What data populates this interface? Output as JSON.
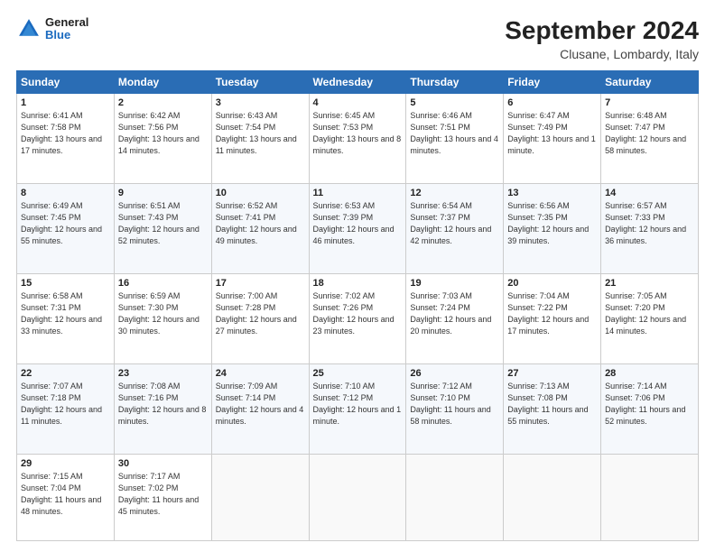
{
  "header": {
    "logo": {
      "general": "General",
      "blue": "Blue"
    },
    "title": "September 2024",
    "location": "Clusane, Lombardy, Italy"
  },
  "weekdays": [
    "Sunday",
    "Monday",
    "Tuesday",
    "Wednesday",
    "Thursday",
    "Friday",
    "Saturday"
  ],
  "weeks": [
    [
      {
        "day": "1",
        "sunrise": "6:41 AM",
        "sunset": "7:58 PM",
        "daylight": "13 hours and 17 minutes."
      },
      {
        "day": "2",
        "sunrise": "6:42 AM",
        "sunset": "7:56 PM",
        "daylight": "13 hours and 14 minutes."
      },
      {
        "day": "3",
        "sunrise": "6:43 AM",
        "sunset": "7:54 PM",
        "daylight": "13 hours and 11 minutes."
      },
      {
        "day": "4",
        "sunrise": "6:45 AM",
        "sunset": "7:53 PM",
        "daylight": "13 hours and 8 minutes."
      },
      {
        "day": "5",
        "sunrise": "6:46 AM",
        "sunset": "7:51 PM",
        "daylight": "13 hours and 4 minutes."
      },
      {
        "day": "6",
        "sunrise": "6:47 AM",
        "sunset": "7:49 PM",
        "daylight": "13 hours and 1 minute."
      },
      {
        "day": "7",
        "sunrise": "6:48 AM",
        "sunset": "7:47 PM",
        "daylight": "12 hours and 58 minutes."
      }
    ],
    [
      {
        "day": "8",
        "sunrise": "6:49 AM",
        "sunset": "7:45 PM",
        "daylight": "12 hours and 55 minutes."
      },
      {
        "day": "9",
        "sunrise": "6:51 AM",
        "sunset": "7:43 PM",
        "daylight": "12 hours and 52 minutes."
      },
      {
        "day": "10",
        "sunrise": "6:52 AM",
        "sunset": "7:41 PM",
        "daylight": "12 hours and 49 minutes."
      },
      {
        "day": "11",
        "sunrise": "6:53 AM",
        "sunset": "7:39 PM",
        "daylight": "12 hours and 46 minutes."
      },
      {
        "day": "12",
        "sunrise": "6:54 AM",
        "sunset": "7:37 PM",
        "daylight": "12 hours and 42 minutes."
      },
      {
        "day": "13",
        "sunrise": "6:56 AM",
        "sunset": "7:35 PM",
        "daylight": "12 hours and 39 minutes."
      },
      {
        "day": "14",
        "sunrise": "6:57 AM",
        "sunset": "7:33 PM",
        "daylight": "12 hours and 36 minutes."
      }
    ],
    [
      {
        "day": "15",
        "sunrise": "6:58 AM",
        "sunset": "7:31 PM",
        "daylight": "12 hours and 33 minutes."
      },
      {
        "day": "16",
        "sunrise": "6:59 AM",
        "sunset": "7:30 PM",
        "daylight": "12 hours and 30 minutes."
      },
      {
        "day": "17",
        "sunrise": "7:00 AM",
        "sunset": "7:28 PM",
        "daylight": "12 hours and 27 minutes."
      },
      {
        "day": "18",
        "sunrise": "7:02 AM",
        "sunset": "7:26 PM",
        "daylight": "12 hours and 23 minutes."
      },
      {
        "day": "19",
        "sunrise": "7:03 AM",
        "sunset": "7:24 PM",
        "daylight": "12 hours and 20 minutes."
      },
      {
        "day": "20",
        "sunrise": "7:04 AM",
        "sunset": "7:22 PM",
        "daylight": "12 hours and 17 minutes."
      },
      {
        "day": "21",
        "sunrise": "7:05 AM",
        "sunset": "7:20 PM",
        "daylight": "12 hours and 14 minutes."
      }
    ],
    [
      {
        "day": "22",
        "sunrise": "7:07 AM",
        "sunset": "7:18 PM",
        "daylight": "12 hours and 11 minutes."
      },
      {
        "day": "23",
        "sunrise": "7:08 AM",
        "sunset": "7:16 PM",
        "daylight": "12 hours and 8 minutes."
      },
      {
        "day": "24",
        "sunrise": "7:09 AM",
        "sunset": "7:14 PM",
        "daylight": "12 hours and 4 minutes."
      },
      {
        "day": "25",
        "sunrise": "7:10 AM",
        "sunset": "7:12 PM",
        "daylight": "12 hours and 1 minute."
      },
      {
        "day": "26",
        "sunrise": "7:12 AM",
        "sunset": "7:10 PM",
        "daylight": "11 hours and 58 minutes."
      },
      {
        "day": "27",
        "sunrise": "7:13 AM",
        "sunset": "7:08 PM",
        "daylight": "11 hours and 55 minutes."
      },
      {
        "day": "28",
        "sunrise": "7:14 AM",
        "sunset": "7:06 PM",
        "daylight": "11 hours and 52 minutes."
      }
    ],
    [
      {
        "day": "29",
        "sunrise": "7:15 AM",
        "sunset": "7:04 PM",
        "daylight": "11 hours and 48 minutes."
      },
      {
        "day": "30",
        "sunrise": "7:17 AM",
        "sunset": "7:02 PM",
        "daylight": "11 hours and 45 minutes."
      },
      null,
      null,
      null,
      null,
      null
    ]
  ]
}
